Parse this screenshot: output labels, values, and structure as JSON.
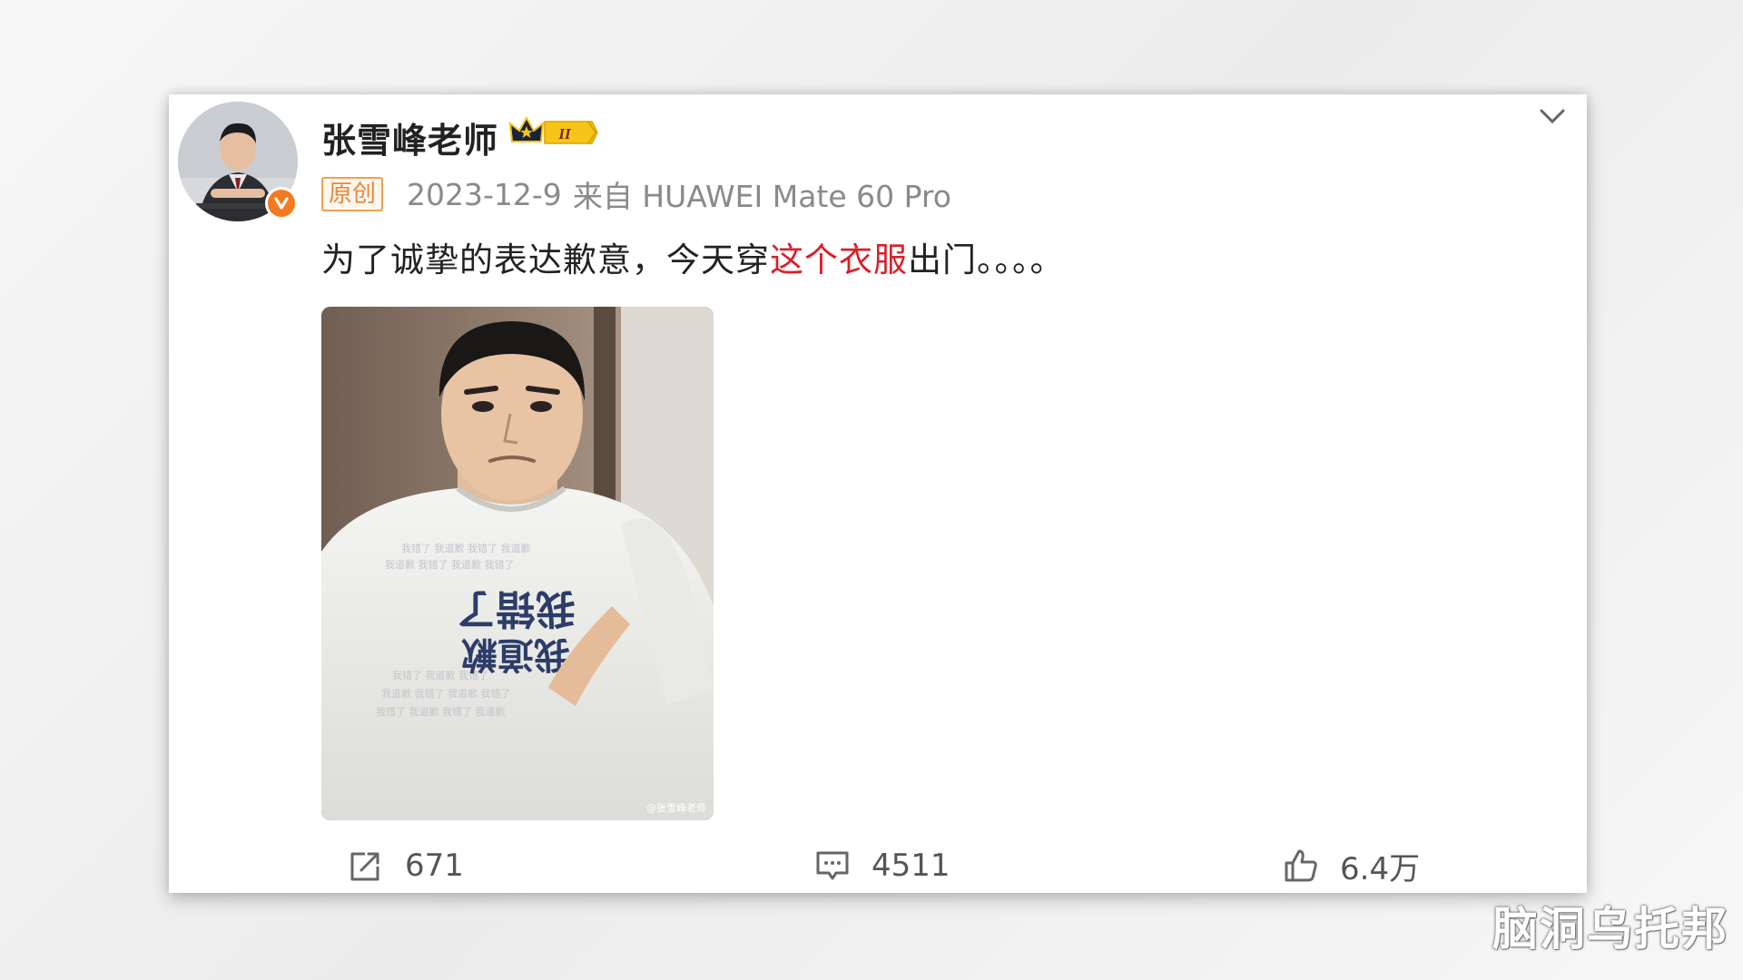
{
  "post": {
    "username": "张雪峰老师",
    "vip_level": "II",
    "original_tag": "原创",
    "date": "2023-12-9",
    "source": "来自 HUAWEI Mate 60 Pro",
    "text_before": "为了诚挚的表达歉意，今天穿",
    "text_highlight": "这个衣服",
    "text_after": "出门。。。。",
    "image": {
      "shirt_line_1": "我错了",
      "shirt_line_2": "我道歉",
      "image_watermark": "@张雪峰老师"
    }
  },
  "actions": {
    "repost_count": "671",
    "comment_count": "4511",
    "like_count": "6.4万"
  },
  "watermark": "脑洞乌托邦",
  "icons": {
    "collapse": "chevron-down-icon",
    "verified": "verified-v-icon",
    "vip": "crown-vip-icon",
    "repost": "share-icon",
    "comment": "comment-icon",
    "like": "thumbs-up-icon"
  },
  "colors": {
    "highlight": "#d8202a",
    "verified": "#f47a1f",
    "vip_gold": "#f5c518",
    "original_tag": "#e8863a"
  }
}
